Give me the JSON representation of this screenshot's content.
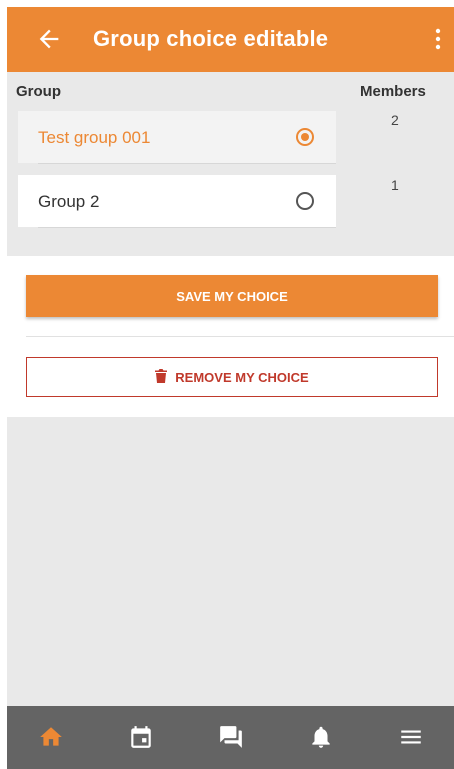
{
  "header": {
    "title": "Group choice editable",
    "back_icon": "arrow-left-icon",
    "more_icon": "more-vert-icon"
  },
  "columns": {
    "group": "Group",
    "members": "Members"
  },
  "groups": [
    {
      "name": "Test group 001",
      "members": "2",
      "selected": true
    },
    {
      "name": "Group 2",
      "members": "1",
      "selected": false
    }
  ],
  "actions": {
    "save_label": "SAVE MY CHOICE",
    "remove_label": "REMOVE MY CHOICE",
    "remove_icon": "trash-icon"
  },
  "bottom_nav": [
    {
      "icon": "home-icon",
      "active": true
    },
    {
      "icon": "calendar-icon",
      "active": false
    },
    {
      "icon": "chat-icon",
      "active": false
    },
    {
      "icon": "bell-icon",
      "active": false
    },
    {
      "icon": "menu-icon",
      "active": false
    }
  ],
  "colors": {
    "accent": "#ec8834",
    "danger": "#c0392b",
    "nav_bg": "#646464",
    "nav_inactive": "#ffffff"
  }
}
